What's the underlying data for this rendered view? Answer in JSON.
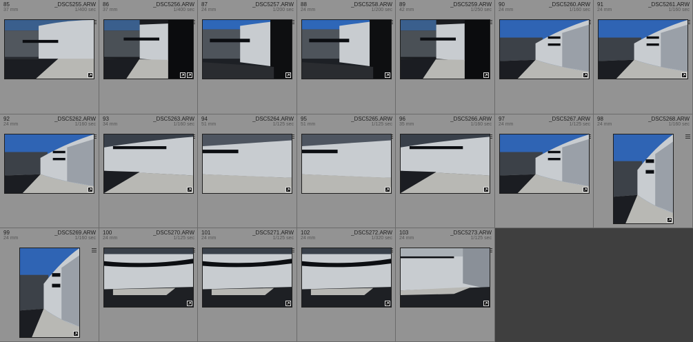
{
  "cells": [
    {
      "index": "85",
      "filename": "_DSC5255.ARW",
      "focal": "37 mm",
      "shutter": "1/400 sec",
      "scene": "a",
      "extra_badge": false
    },
    {
      "index": "86",
      "filename": "_DSC5256.ARW",
      "focal": "37 mm",
      "shutter": "1/400 sec",
      "scene": "b",
      "extra_badge": true
    },
    {
      "index": "87",
      "filename": "_DSC5257.ARW",
      "focal": "24 mm",
      "shutter": "1/200 sec",
      "scene": "c",
      "extra_badge": false
    },
    {
      "index": "88",
      "filename": "_DSC5258.ARW",
      "focal": "24 mm",
      "shutter": "1/200 sec",
      "scene": "c",
      "extra_badge": false
    },
    {
      "index": "89",
      "filename": "_DSC5259.ARW",
      "focal": "42 mm",
      "shutter": "1/250 sec",
      "scene": "b",
      "extra_badge": false
    },
    {
      "index": "90",
      "filename": "_DSC5260.ARW",
      "focal": "24 mm",
      "shutter": "1/160 sec",
      "scene": "d",
      "extra_badge": false
    },
    {
      "index": "91",
      "filename": "_DSC5261.ARW",
      "focal": "24 mm",
      "shutter": "1/160 sec",
      "scene": "d",
      "extra_badge": false
    },
    {
      "index": "92",
      "filename": "_DSC5262.ARW",
      "focal": "24 mm",
      "shutter": "1/160 sec",
      "scene": "d",
      "extra_badge": false
    },
    {
      "index": "93",
      "filename": "_DSC5263.ARW",
      "focal": "34 mm",
      "shutter": "1/160 sec",
      "scene": "e",
      "extra_badge": false
    },
    {
      "index": "94",
      "filename": "_DSC5264.ARW",
      "focal": "51 mm",
      "shutter": "1/125 sec",
      "scene": "f",
      "extra_badge": false
    },
    {
      "index": "95",
      "filename": "_DSC5265.ARW",
      "focal": "51 mm",
      "shutter": "1/125 sec",
      "scene": "f",
      "extra_badge": false
    },
    {
      "index": "96",
      "filename": "_DSC5266.ARW",
      "focal": "35 mm",
      "shutter": "1/160 sec",
      "scene": "e",
      "extra_badge": false
    },
    {
      "index": "97",
      "filename": "_DSC5267.ARW",
      "focal": "24 mm",
      "shutter": "1/125 sec",
      "scene": "d",
      "extra_badge": false
    },
    {
      "index": "98",
      "filename": "_DSC5268.ARW",
      "focal": "24 mm",
      "shutter": "1/160 sec",
      "scene": "d",
      "extra_badge": false
    },
    {
      "index": "99",
      "filename": "_DSC5269.ARW",
      "focal": "24 mm",
      "shutter": "1/160 sec",
      "scene": "d",
      "extra_badge": false
    },
    {
      "index": "100",
      "filename": "_DSC5270.ARW",
      "focal": "24 mm",
      "shutter": "1/125 sec",
      "scene": "g",
      "extra_badge": false
    },
    {
      "index": "101",
      "filename": "_DSC5271.ARW",
      "focal": "24 mm",
      "shutter": "1/125 sec",
      "scene": "g",
      "extra_badge": false
    },
    {
      "index": "102",
      "filename": "_DSC5272.ARW",
      "focal": "24 mm",
      "shutter": "1/320 sec",
      "scene": "g",
      "extra_badge": false
    },
    {
      "index": "103",
      "filename": "_DSC5273.ARW",
      "focal": "24 mm",
      "shutter": "1/125 sec",
      "scene": "h",
      "extra_badge": false
    }
  ],
  "colors": {
    "cell_bg": "#939393",
    "grid_bg": "#3f3f3f",
    "sky": "#2f64b4",
    "wall": "#c8ccd0",
    "shadow": "#1b1d22",
    "ground": "#b8b8b4"
  }
}
